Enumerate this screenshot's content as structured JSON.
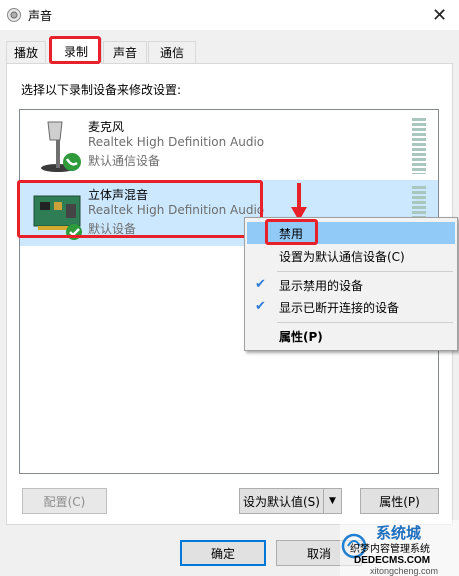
{
  "window": {
    "title": "声音"
  },
  "tabs": [
    {
      "label": "播放",
      "active": false
    },
    {
      "label": "录制",
      "active": true
    },
    {
      "label": "声音",
      "active": false
    },
    {
      "label": "通信",
      "active": false
    }
  ],
  "instruction": "选择以下录制设备来修改设置:",
  "devices": [
    {
      "name": "麦克风",
      "driver": "Realtek High Definition Audio",
      "status": "默认通信设备",
      "icon": "microphone-icon",
      "selected": false
    },
    {
      "name": "立体声混音",
      "driver": "Realtek High Definition Audio",
      "status": "默认设备",
      "icon": "sound-card-icon",
      "selected": true
    }
  ],
  "context_menu": {
    "items": [
      {
        "label": "禁用",
        "highlighted": true
      },
      {
        "label": "设置为默认通信设备(C)"
      },
      {
        "label": "显示禁用的设备",
        "checked": true
      },
      {
        "label": "显示已断开连接的设备",
        "checked": true
      },
      {
        "label": "属性(P)",
        "bold": true
      }
    ]
  },
  "buttons": {
    "configure": "配置(C)",
    "set_default": "设为默认值(S)",
    "properties": "属性(P)",
    "ok": "确定",
    "cancel": "取消"
  },
  "watermark": {
    "lines": [
      "系统城",
      "织梦内容管理系统",
      "DEDECMS.COM",
      "xitongcheng.com"
    ]
  },
  "colors": {
    "highlight_box": "#e8202a",
    "selected_row": "#cce8ff",
    "menu_hover": "#91c9f7",
    "accent": "#0078d7"
  }
}
